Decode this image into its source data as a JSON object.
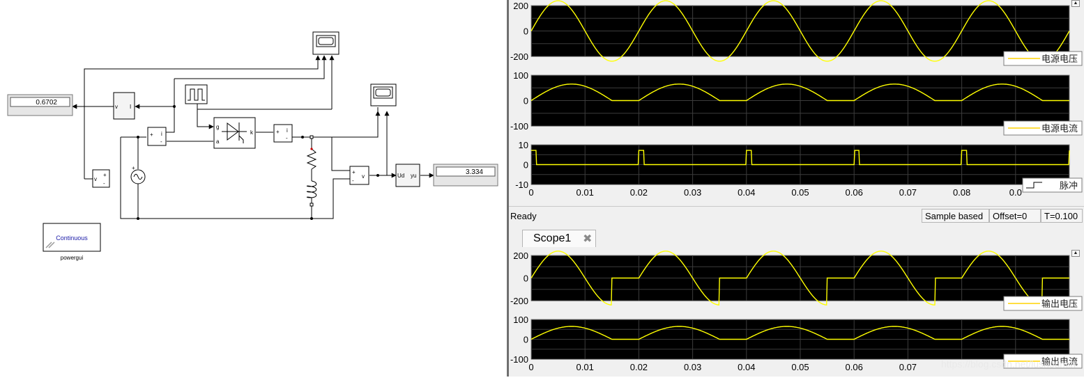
{
  "model": {
    "display1_value": "0.6702",
    "display2_value": "3.334",
    "powergui_block_text": "Continuous",
    "powergui_name": "powergui",
    "block_ud_label": "Ud",
    "block_yu_label": "yu",
    "thyristor_port_g": "g",
    "thyristor_port_a": "a",
    "thyristor_port_k": "k",
    "voltmeter_label": "v",
    "ammeter_label": "i",
    "rms_input_label": "v",
    "rms_output_label": "I"
  },
  "scope_top": {
    "axes": [
      {
        "y_ticks": [
          "200",
          "0",
          "-200"
        ],
        "legend": "电源电压"
      },
      {
        "y_ticks": [
          "100",
          "0",
          "-100"
        ],
        "legend": "电源电流"
      },
      {
        "y_ticks": [
          "10",
          "0",
          "-10"
        ],
        "legend": "脉冲",
        "x_ticks": [
          "0",
          "0.01",
          "0.02",
          "0.03",
          "0.04",
          "0.05",
          "0.06",
          "0.07",
          "0.08",
          "0.0"
        ]
      }
    ]
  },
  "status": {
    "ready": "Ready",
    "sample": "Sample based",
    "offset": "Offset=0",
    "time": "T=0.100"
  },
  "scope1": {
    "tab_label": "Scope1",
    "axes": [
      {
        "y_ticks": [
          "200",
          "0",
          "-200"
        ],
        "legend": "输出电压"
      },
      {
        "y_ticks": [
          "100",
          "0",
          "-100"
        ],
        "legend": "输出电流",
        "x_ticks": [
          "0",
          "0.01",
          "0.02",
          "0.03",
          "0.04",
          "0.05",
          "0.06",
          "0.07"
        ]
      }
    ]
  },
  "watermark": "https://blog.csdn.net/lushoumin",
  "colors": {
    "trace": "#ffff00",
    "plot_bg": "#000000",
    "grid": "#3c3c3c"
  }
}
